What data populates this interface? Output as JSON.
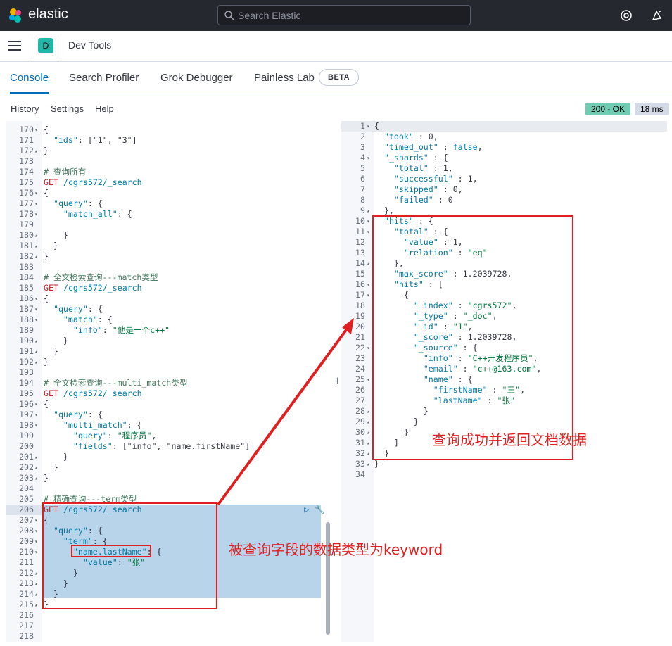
{
  "header": {
    "brand": "elastic",
    "search_placeholder": "Search Elastic",
    "help_icon": "lifebuoy-icon",
    "news_icon": "newsfeed-icon"
  },
  "nav": {
    "avatar_letter": "D",
    "page_title": "Dev Tools"
  },
  "tabs": [
    "Console",
    "Search Profiler",
    "Grok Debugger",
    "Painless Lab"
  ],
  "beta_label": "BETA",
  "console_menu": [
    "History",
    "Settings",
    "Help"
  ],
  "status": {
    "code": "200 - OK",
    "time": "18 ms"
  },
  "colors": {
    "accent": "#006bb8",
    "annotation": "#e02020",
    "selection": "#b8d4ea"
  },
  "left_lines": [
    {
      "n": "170",
      "f": "▾",
      "t": "{"
    },
    {
      "n": "171",
      "f": "",
      "t": "  \"ids\": [\"1\", \"3\"]"
    },
    {
      "n": "172",
      "f": "▴",
      "t": "}"
    },
    {
      "n": "173",
      "f": "",
      "t": ""
    },
    {
      "n": "174",
      "f": "",
      "t": "# 查询所有"
    },
    {
      "n": "175",
      "f": "",
      "t": "GET /cgrs572/_search"
    },
    {
      "n": "176",
      "f": "▾",
      "t": "{"
    },
    {
      "n": "177",
      "f": "▾",
      "t": "  \"query\": {"
    },
    {
      "n": "178",
      "f": "▾",
      "t": "    \"match_all\": {"
    },
    {
      "n": "179",
      "f": "",
      "t": "      "
    },
    {
      "n": "180",
      "f": "▴",
      "t": "    }"
    },
    {
      "n": "181",
      "f": "▴",
      "t": "  }"
    },
    {
      "n": "182",
      "f": "▴",
      "t": "}"
    },
    {
      "n": "183",
      "f": "",
      "t": ""
    },
    {
      "n": "184",
      "f": "",
      "t": "# 全文检索查询---match类型"
    },
    {
      "n": "185",
      "f": "",
      "t": "GET /cgrs572/_search"
    },
    {
      "n": "186",
      "f": "▾",
      "t": "{"
    },
    {
      "n": "187",
      "f": "▾",
      "t": "  \"query\": {"
    },
    {
      "n": "188",
      "f": "▾",
      "t": "    \"match\": {"
    },
    {
      "n": "189",
      "f": "",
      "t": "      \"info\": \"他是一个c++\""
    },
    {
      "n": "190",
      "f": "▴",
      "t": "    }"
    },
    {
      "n": "191",
      "f": "▴",
      "t": "  }"
    },
    {
      "n": "192",
      "f": "▴",
      "t": "}"
    },
    {
      "n": "193",
      "f": "",
      "t": ""
    },
    {
      "n": "194",
      "f": "",
      "t": "# 全文检索查询---multi_match类型"
    },
    {
      "n": "195",
      "f": "",
      "t": "GET /cgrs572/_search"
    },
    {
      "n": "196",
      "f": "▾",
      "t": "{"
    },
    {
      "n": "197",
      "f": "▾",
      "t": "  \"query\": {"
    },
    {
      "n": "198",
      "f": "▾",
      "t": "    \"multi_match\": {"
    },
    {
      "n": "199",
      "f": "",
      "t": "      \"query\": \"程序员\","
    },
    {
      "n": "200",
      "f": "",
      "t": "      \"fields\": [\"info\", \"name.firstName\"]"
    },
    {
      "n": "201",
      "f": "▴",
      "t": "    }"
    },
    {
      "n": "202",
      "f": "▴",
      "t": "  }"
    },
    {
      "n": "203",
      "f": "▴",
      "t": "}"
    },
    {
      "n": "204",
      "f": "",
      "t": ""
    },
    {
      "n": "205",
      "f": "",
      "t": "# 精确查询---term类型"
    },
    {
      "n": "206",
      "f": "",
      "t": "GET /cgrs572/_search"
    },
    {
      "n": "207",
      "f": "▾",
      "t": "{"
    },
    {
      "n": "208",
      "f": "▾",
      "t": "  \"query\": {"
    },
    {
      "n": "209",
      "f": "▾",
      "t": "    \"term\": {"
    },
    {
      "n": "210",
      "f": "▾",
      "t": "      \"name.lastName\": {"
    },
    {
      "n": "211",
      "f": "",
      "t": "        \"value\": \"张\""
    },
    {
      "n": "212",
      "f": "▴",
      "t": "      }"
    },
    {
      "n": "213",
      "f": "▴",
      "t": "    }"
    },
    {
      "n": "214",
      "f": "▴",
      "t": "  }"
    },
    {
      "n": "215",
      "f": "▴",
      "t": "}"
    },
    {
      "n": "216",
      "f": "",
      "t": ""
    },
    {
      "n": "217",
      "f": "",
      "t": ""
    },
    {
      "n": "218",
      "f": "",
      "t": ""
    }
  ],
  "right_lines": [
    {
      "n": "1",
      "f": "▾",
      "t": "{"
    },
    {
      "n": "2",
      "f": "",
      "t": "  \"took\" : 0,"
    },
    {
      "n": "3",
      "f": "",
      "t": "  \"timed_out\" : false,"
    },
    {
      "n": "4",
      "f": "▾",
      "t": "  \"_shards\" : {"
    },
    {
      "n": "5",
      "f": "",
      "t": "    \"total\" : 1,"
    },
    {
      "n": "6",
      "f": "",
      "t": "    \"successful\" : 1,"
    },
    {
      "n": "7",
      "f": "",
      "t": "    \"skipped\" : 0,"
    },
    {
      "n": "8",
      "f": "",
      "t": "    \"failed\" : 0"
    },
    {
      "n": "9",
      "f": "▴",
      "t": "  },"
    },
    {
      "n": "10",
      "f": "▾",
      "t": "  \"hits\" : {"
    },
    {
      "n": "11",
      "f": "▾",
      "t": "    \"total\" : {"
    },
    {
      "n": "12",
      "f": "",
      "t": "      \"value\" : 1,"
    },
    {
      "n": "13",
      "f": "",
      "t": "      \"relation\" : \"eq\""
    },
    {
      "n": "14",
      "f": "▴",
      "t": "    },"
    },
    {
      "n": "15",
      "f": "",
      "t": "    \"max_score\" : 1.2039728,"
    },
    {
      "n": "16",
      "f": "▾",
      "t": "    \"hits\" : ["
    },
    {
      "n": "17",
      "f": "▾",
      "t": "      {"
    },
    {
      "n": "18",
      "f": "",
      "t": "        \"_index\" : \"cgrs572\","
    },
    {
      "n": "19",
      "f": "",
      "t": "        \"_type\" : \"_doc\","
    },
    {
      "n": "20",
      "f": "",
      "t": "        \"_id\" : \"1\","
    },
    {
      "n": "21",
      "f": "",
      "t": "        \"_score\" : 1.2039728,"
    },
    {
      "n": "22",
      "f": "▾",
      "t": "        \"_source\" : {"
    },
    {
      "n": "23",
      "f": "",
      "t": "          \"info\" : \"C++开发程序员\","
    },
    {
      "n": "24",
      "f": "",
      "t": "          \"email\" : \"c++@163.com\","
    },
    {
      "n": "25",
      "f": "▾",
      "t": "          \"name\" : {"
    },
    {
      "n": "26",
      "f": "",
      "t": "            \"firstName\" : \"三\","
    },
    {
      "n": "27",
      "f": "",
      "t": "            \"lastName\" : \"张\""
    },
    {
      "n": "28",
      "f": "▴",
      "t": "          }"
    },
    {
      "n": "29",
      "f": "▴",
      "t": "        }"
    },
    {
      "n": "30",
      "f": "▴",
      "t": "      }"
    },
    {
      "n": "31",
      "f": "▴",
      "t": "    ]"
    },
    {
      "n": "32",
      "f": "▴",
      "t": "  }"
    },
    {
      "n": "33",
      "f": "▴",
      "t": "}"
    },
    {
      "n": "34",
      "f": "",
      "t": ""
    }
  ],
  "annotations": {
    "request_note": "被查询字段的数据类型为keyword",
    "response_note": "查询成功并返回文档数据"
  }
}
